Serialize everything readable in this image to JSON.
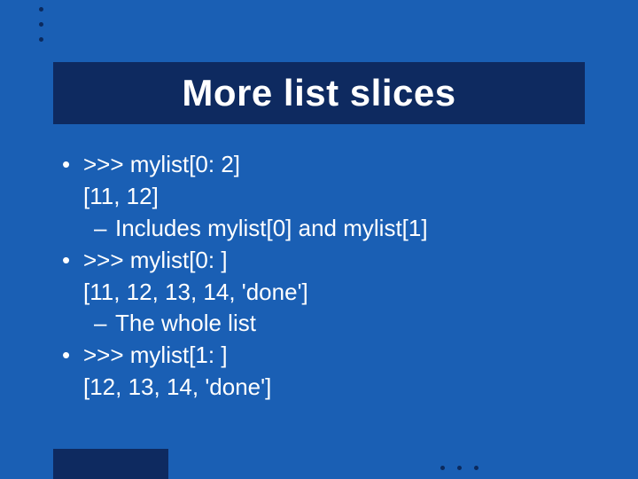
{
  "slide": {
    "title": "More list slices",
    "items": [
      {
        "prompt": ">>> mylist[0: 2]",
        "output": "[11, 12]",
        "note": "Includes mylist[0] and mylist[1]"
      },
      {
        "prompt": ">>> mylist[0: ]",
        "output": "[11, 12, 13, 14, 'done']",
        "note": "The whole list"
      },
      {
        "prompt": ">>> mylist[1: ]",
        "output": "[12, 13, 14, 'done']"
      }
    ]
  }
}
